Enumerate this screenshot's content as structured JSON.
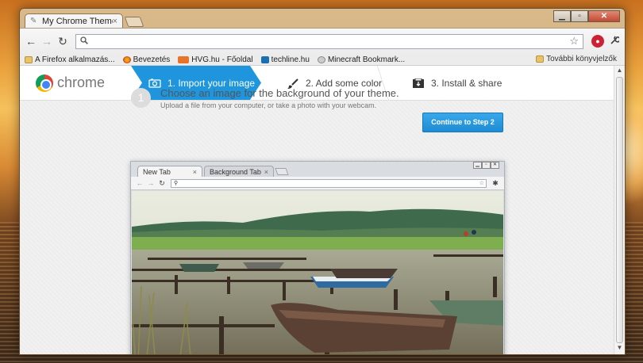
{
  "window": {
    "tab_title": "My Chrome Theme",
    "tab_close": "×",
    "controls": {
      "minimize": "▁",
      "maximize": "▫",
      "close": "✕"
    }
  },
  "toolbar": {
    "back": "←",
    "forward": "→",
    "reload": "↻",
    "omnibox_value": "",
    "star": "☆",
    "wrench": "🔧"
  },
  "bookmarks": {
    "items": [
      {
        "label": "A Firefox alkalmazás...",
        "icon": "folder-icon"
      },
      {
        "label": "Bevezetés",
        "icon": "firefox-icon"
      },
      {
        "label": "HVG.hu - Főoldal",
        "icon": "hvg-icon"
      },
      {
        "label": "techline.hu",
        "icon": "techline-icon"
      },
      {
        "label": "Minecraft Bookmark...",
        "icon": "globe-icon"
      }
    ],
    "other": "További könyvjelzők"
  },
  "app": {
    "logo_text": "chrome",
    "steps": [
      {
        "label": "1. Import your image",
        "icon": "camera-icon",
        "active": true
      },
      {
        "label": "2. Add some color",
        "icon": "brush-icon",
        "active": false
      },
      {
        "label": "3. Install & share",
        "icon": "package-icon",
        "active": false
      }
    ],
    "step_number": "1",
    "heading": "Choose an image for the background of your theme.",
    "subtext": "Upload a file from your computer, or take a photo with your webcam.",
    "continue_button": "Continue to Step 2",
    "accent_color": "#1e95dc"
  },
  "preview": {
    "tabs": [
      {
        "label": "New Tab",
        "close": "×"
      },
      {
        "label": "Background Tab",
        "close": "×"
      }
    ],
    "back": "←",
    "forward": "→",
    "reload": "↻",
    "search_glyph": "🔍",
    "star": "☆",
    "wrench": "🔧"
  }
}
